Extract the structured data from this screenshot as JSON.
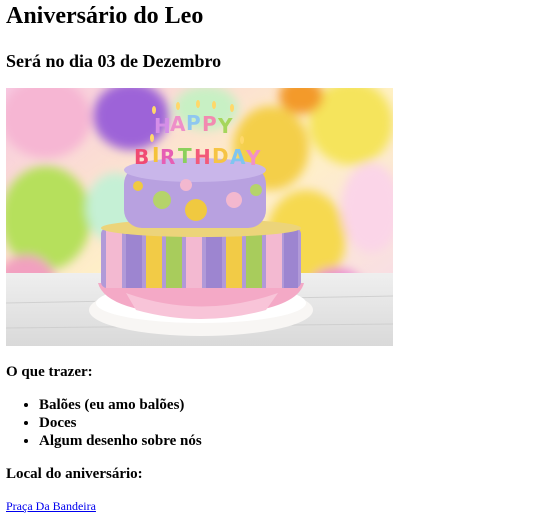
{
  "page": {
    "title": "Aniversário do Leo",
    "subtitle": "Será no dia 03 de Dezembro"
  },
  "image": {
    "subject": "birthday-cake-photo",
    "cake_text": "HAPPY BIRTHDAY",
    "colors": {
      "purple": "#a58fd4",
      "pink": "#f3b8cf",
      "green": "#b5d36a",
      "yellow": "#f0c940",
      "plate": "#f5f3f2"
    }
  },
  "bring": {
    "heading": "O que trazer:",
    "items": [
      "Balões (eu amo balões)",
      "Doces",
      "Algum desenho sobre nós"
    ]
  },
  "location": {
    "heading": "Local do aniversário:",
    "link_text": "Praça Da Bandeira"
  }
}
